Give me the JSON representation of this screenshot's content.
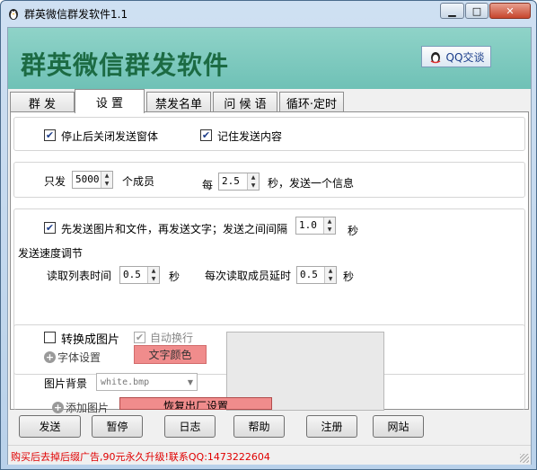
{
  "window": {
    "title": "群英微信群发软件1.1",
    "controls": {
      "minimize": "▁",
      "maximize": "□",
      "close": "✕"
    },
    "app_icon": "penguin-icon"
  },
  "header": {
    "app_title": "群英微信群发软件",
    "qq_button": "QQ交谈"
  },
  "tabs": [
    {
      "label": "群 发",
      "active": false
    },
    {
      "label": "设 置",
      "active": true
    },
    {
      "label": "禁发名单",
      "active": false
    },
    {
      "label": "问 候 语",
      "active": false
    },
    {
      "label": "循环·定时",
      "active": false
    }
  ],
  "settings": {
    "close_after_send": {
      "label": "停止后关闭发送窗体",
      "checked": true
    },
    "remember_content": {
      "label": "记住发送内容",
      "checked": true
    },
    "batch": {
      "prefix": "只发",
      "count": "5000",
      "members_label": "个成员",
      "every_label": "每",
      "interval": "2.5",
      "suffix": "秒，发送一个信息"
    },
    "image_first": {
      "label": "先发送图片和文件，再发送文字；发送之间间隔",
      "checked": true,
      "value": "1.0",
      "unit": "秒"
    },
    "speed": {
      "title": "发送速度调节",
      "read_list_label": "读取列表时间",
      "read_list_value": "0.5",
      "read_list_unit": "秒",
      "member_delay_label": "每次读取成员延时",
      "member_delay_value": "0.5",
      "member_delay_unit": "秒"
    },
    "image": {
      "convert_label": "转换成图片",
      "convert_checked": false,
      "wrap_label": "自动换行",
      "wrap_checked": true,
      "font_settings": "字体设置",
      "text_color": "文字颜色",
      "bg_label": "图片背景",
      "bg_value": "white.bmp",
      "add_image": "添加图片",
      "reset": "恢复出厂设置"
    }
  },
  "buttons": {
    "send": "发送",
    "pause": "暂停",
    "log": "日志",
    "help": "帮助",
    "register": "注册",
    "website": "网站"
  },
  "status": {
    "text": "购买后去掉后缀广告,90元永久升级!联系QQ:1473222604",
    "color": "#e00000"
  }
}
